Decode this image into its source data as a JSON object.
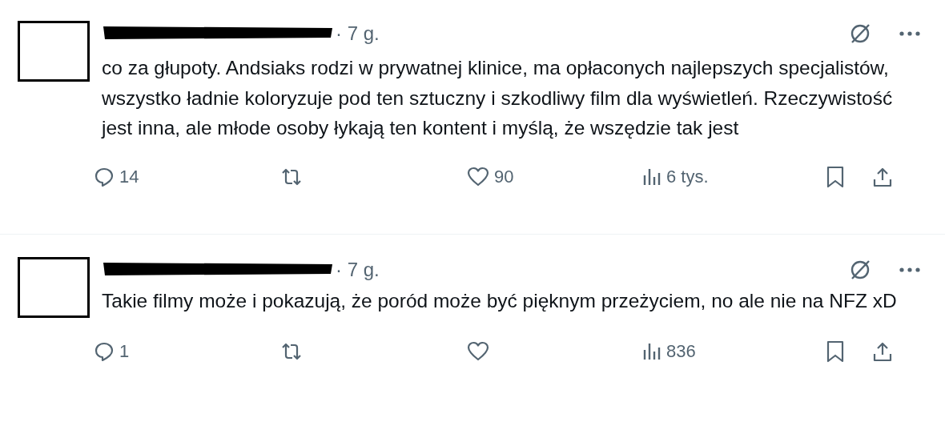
{
  "tweets": [
    {
      "time": "· 7 g.",
      "text": "co za głupoty. Andsiaks rodzi w prywatnej klinice, ma opłaconych najlepszych specjalistów, wszystko ładnie koloryzuje pod ten sztuczny i szkodliwy film dla wyświetleń. Rzeczywistość jest inna, ale młode osoby łykają ten kontent i myślą, że wszędzie tak jest",
      "actions": [
        {
          "kind": "reply",
          "count": "14"
        },
        {
          "kind": "repost"
        },
        {
          "kind": "like",
          "count": "90"
        },
        {
          "kind": "views",
          "count": "6 tys."
        },
        {
          "kind": "bookmark"
        },
        {
          "kind": "share"
        }
      ]
    },
    {
      "time": "· 7 g.",
      "text": "Takie filmy może i pokazują, że poród może być pięknym przeżyciem, no ale nie na NFZ xD",
      "actions": [
        {
          "kind": "reply",
          "count": "1"
        },
        {
          "kind": "repost"
        },
        {
          "kind": "like"
        },
        {
          "kind": "views",
          "count": "836"
        },
        {
          "kind": "bookmark"
        },
        {
          "kind": "share"
        }
      ]
    }
  ]
}
